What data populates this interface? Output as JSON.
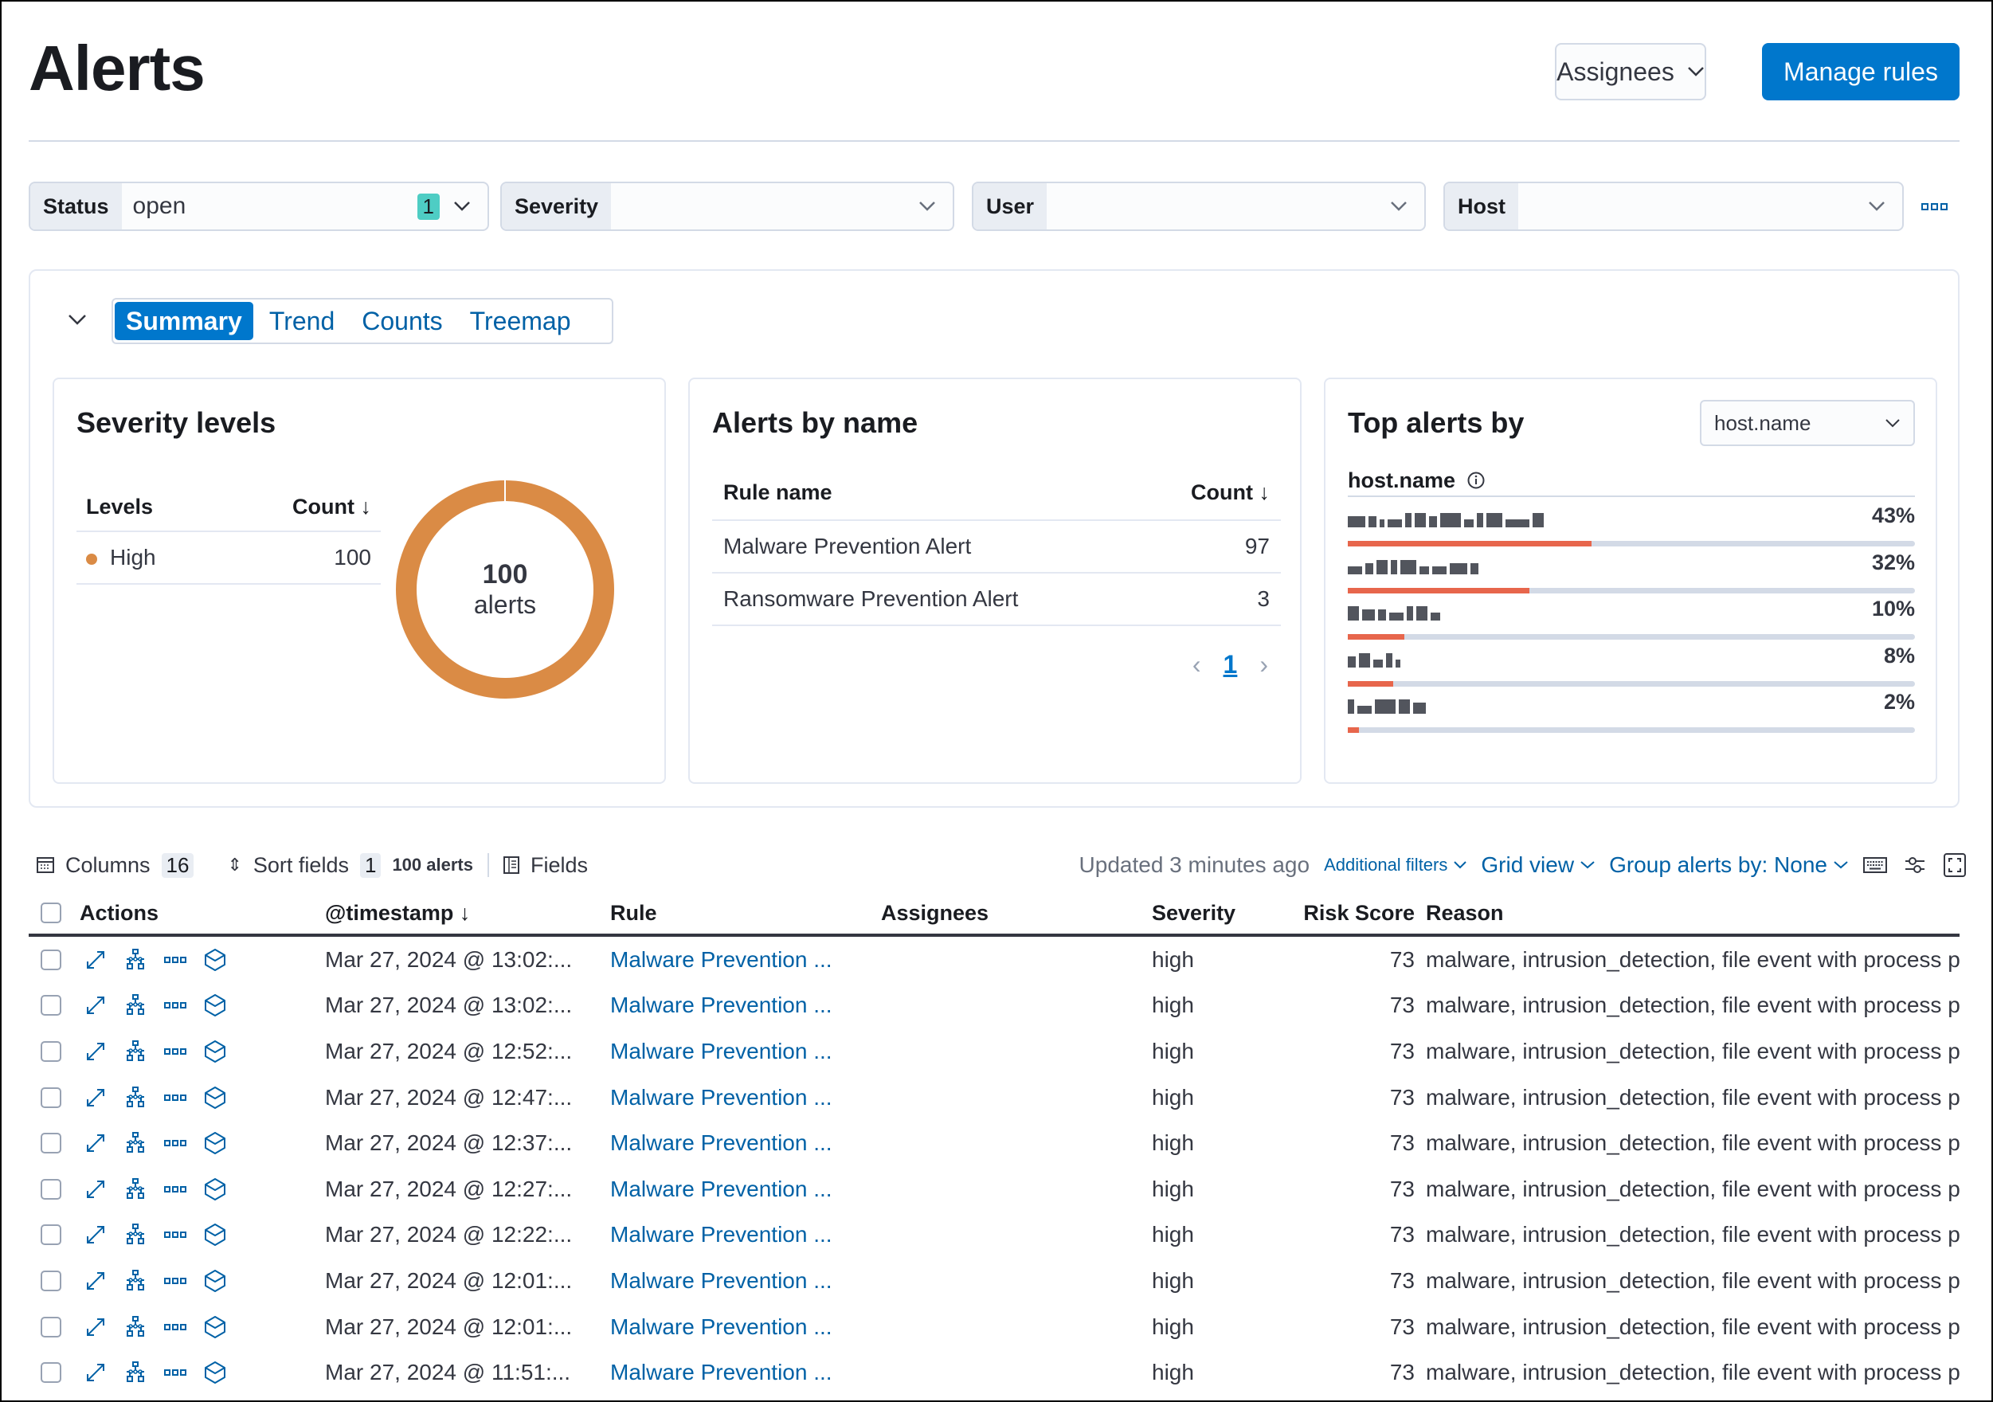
{
  "header": {
    "title": "Alerts",
    "assignees_label": "Assignees",
    "manage_rules_label": "Manage rules"
  },
  "filters": [
    {
      "label": "Status",
      "value": "open",
      "badge": "1"
    },
    {
      "label": "Severity",
      "value": "",
      "badge": ""
    },
    {
      "label": "User",
      "value": "",
      "badge": ""
    },
    {
      "label": "Host",
      "value": "",
      "badge": ""
    }
  ],
  "summary": {
    "tabs": [
      {
        "label": "Summary",
        "active": true
      },
      {
        "label": "Trend",
        "active": false
      },
      {
        "label": "Counts",
        "active": false
      },
      {
        "label": "Treemap",
        "active": false
      }
    ],
    "severity_card": {
      "title": "Severity levels",
      "col_levels": "Levels",
      "col_count": "Count",
      "rows": [
        {
          "level": "High",
          "count": "100",
          "color": "#da8b45"
        }
      ],
      "donut_total": "100",
      "donut_label": "alerts",
      "donut_color": "#da8b45"
    },
    "alerts_by_name_card": {
      "title": "Alerts by name",
      "col_rule": "Rule name",
      "col_count": "Count",
      "rows": [
        {
          "rule": "Malware Prevention Alert",
          "count": "97"
        },
        {
          "rule": "Ransomware Prevention Alert",
          "count": "3"
        }
      ],
      "page": "1"
    },
    "top_alerts_card": {
      "title": "Top alerts by",
      "select_value": "host.name",
      "field_header": "host.name",
      "bar_color": "#e7664c",
      "rows": [
        {
          "name": "[redacted]",
          "percent_label": "43%",
          "percent": 43
        },
        {
          "name": "[redacted]",
          "percent_label": "32%",
          "percent": 32
        },
        {
          "name": "[redacted]",
          "percent_label": "10%",
          "percent": 10
        },
        {
          "name": "[redacted]",
          "percent_label": "8%",
          "percent": 8
        },
        {
          "name": "[redacted]",
          "percent_label": "2%",
          "percent": 2
        }
      ]
    }
  },
  "toolbar": {
    "columns_label": "Columns",
    "columns_count": "16",
    "sort_label": "Sort fields",
    "sort_count": "1",
    "alerts_count": "100 alerts",
    "fields_label": "Fields",
    "updated": "Updated 3 minutes ago",
    "additional_filters": "Additional filters",
    "grid_view": "Grid view",
    "group_by": "Group alerts by: None"
  },
  "table": {
    "headers": {
      "actions": "Actions",
      "timestamp": "@timestamp",
      "rule": "Rule",
      "assignees": "Assignees",
      "severity": "Severity",
      "risk_score": "Risk Score",
      "reason": "Reason"
    },
    "rows": [
      {
        "timestamp": "Mar 27, 2024 @ 13:02:...",
        "rule": "Malware Prevention ...",
        "assignees": "",
        "severity": "high",
        "risk_score": "73",
        "reason": "malware, intrusion_detection, file event with process p"
      },
      {
        "timestamp": "Mar 27, 2024 @ 13:02:...",
        "rule": "Malware Prevention ...",
        "assignees": "",
        "severity": "high",
        "risk_score": "73",
        "reason": "malware, intrusion_detection, file event with process p"
      },
      {
        "timestamp": "Mar 27, 2024 @ 12:52:...",
        "rule": "Malware Prevention ...",
        "assignees": "",
        "severity": "high",
        "risk_score": "73",
        "reason": "malware, intrusion_detection, file event with process p"
      },
      {
        "timestamp": "Mar 27, 2024 @ 12:47:...",
        "rule": "Malware Prevention ...",
        "assignees": "",
        "severity": "high",
        "risk_score": "73",
        "reason": "malware, intrusion_detection, file event with process p"
      },
      {
        "timestamp": "Mar 27, 2024 @ 12:37:...",
        "rule": "Malware Prevention ...",
        "assignees": "",
        "severity": "high",
        "risk_score": "73",
        "reason": "malware, intrusion_detection, file event with process p"
      },
      {
        "timestamp": "Mar 27, 2024 @ 12:27:...",
        "rule": "Malware Prevention ...",
        "assignees": "",
        "severity": "high",
        "risk_score": "73",
        "reason": "malware, intrusion_detection, file event with process p"
      },
      {
        "timestamp": "Mar 27, 2024 @ 12:22:...",
        "rule": "Malware Prevention ...",
        "assignees": "",
        "severity": "high",
        "risk_score": "73",
        "reason": "malware, intrusion_detection, file event with process p"
      },
      {
        "timestamp": "Mar 27, 2024 @ 12:01:...",
        "rule": "Malware Prevention ...",
        "assignees": "",
        "severity": "high",
        "risk_score": "73",
        "reason": "malware, intrusion_detection, file event with process p"
      },
      {
        "timestamp": "Mar 27, 2024 @ 12:01:...",
        "rule": "Malware Prevention ...",
        "assignees": "",
        "severity": "high",
        "risk_score": "73",
        "reason": "malware, intrusion_detection, file event with process p"
      },
      {
        "timestamp": "Mar 27, 2024 @ 11:51:...",
        "rule": "Malware Prevention ...",
        "assignees": "",
        "severity": "high",
        "risk_score": "73",
        "reason": "malware, intrusion_detection, file event with process p"
      }
    ]
  }
}
